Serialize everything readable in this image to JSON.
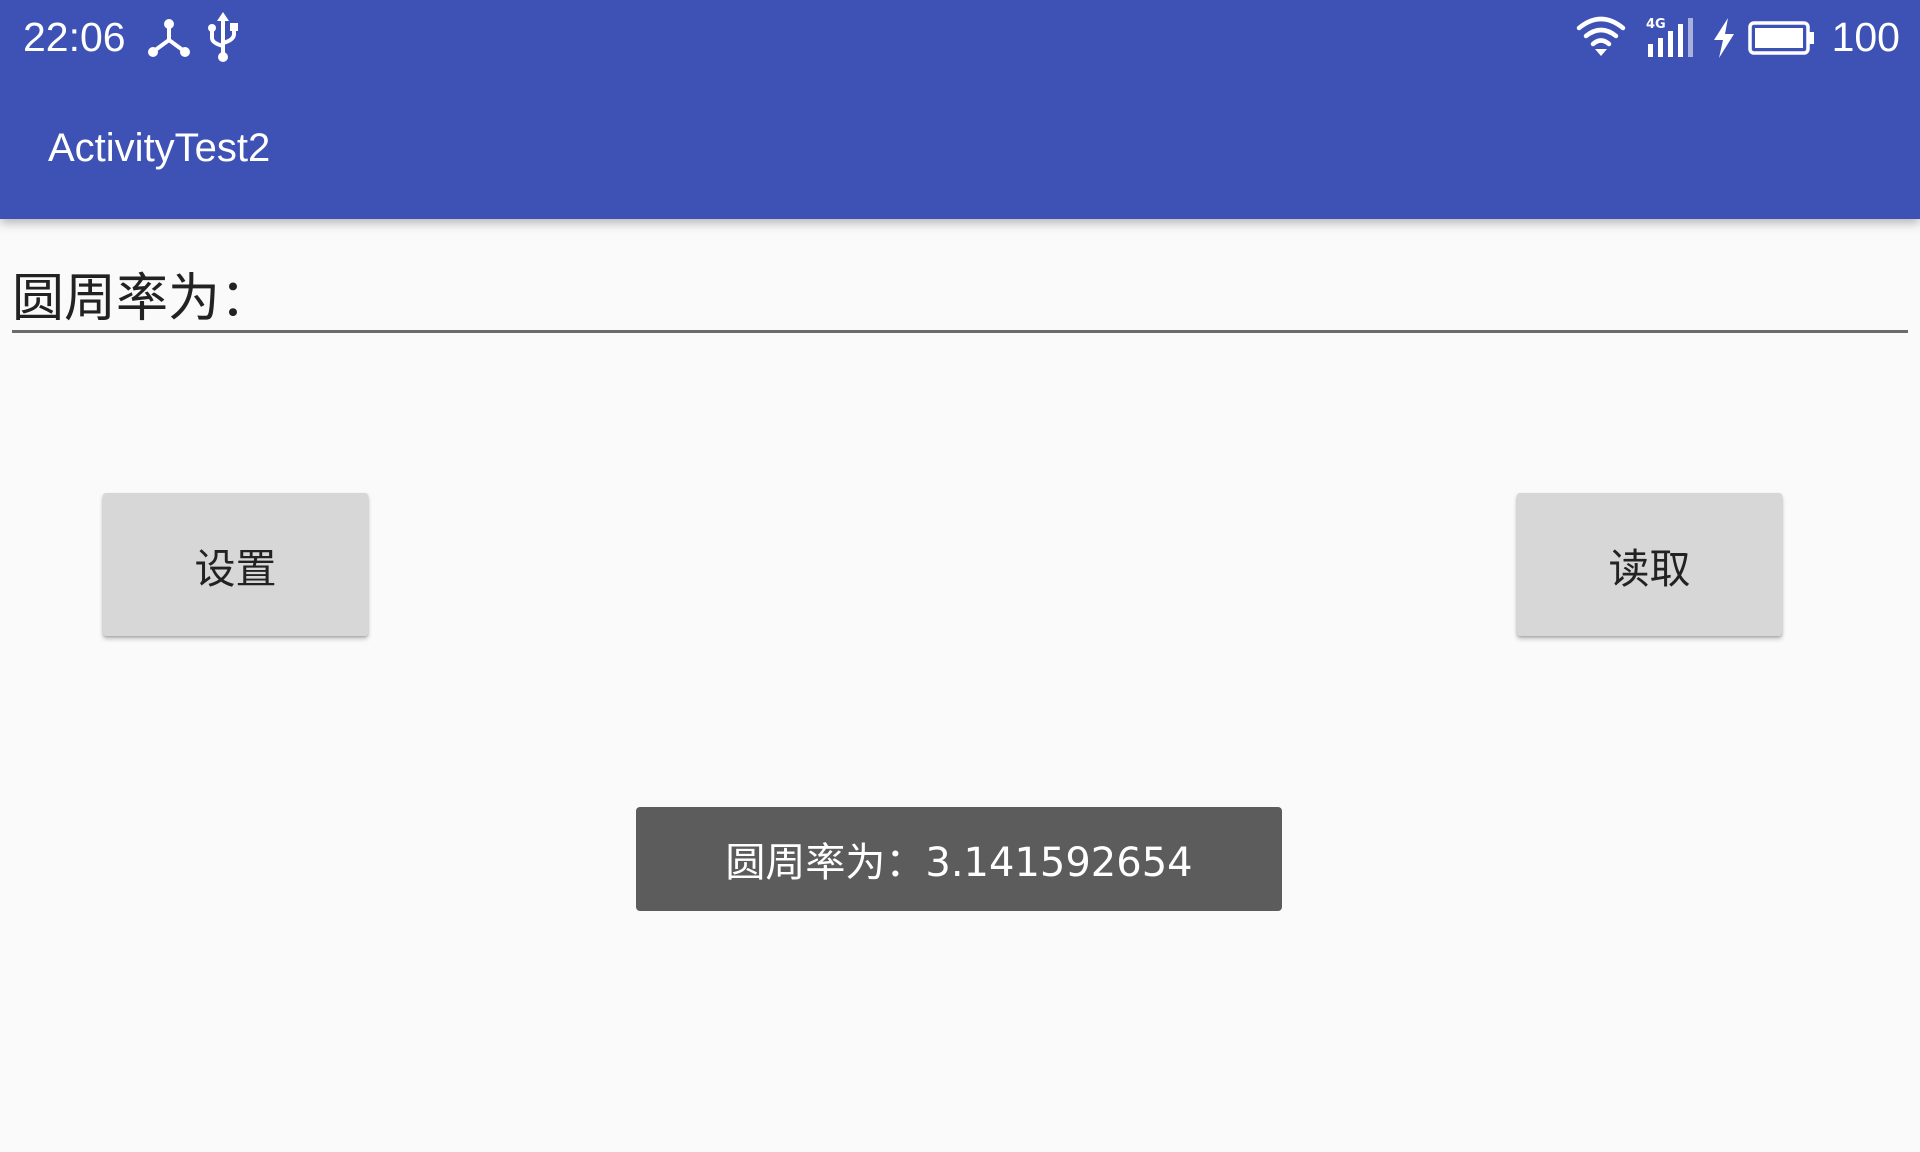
{
  "status_bar": {
    "time": "22:06",
    "battery_level": "100",
    "network_label": "4G",
    "icons": [
      "hotspot-icon",
      "usb-icon",
      "wifi-icon",
      "signal-4g-icon",
      "charging-icon",
      "battery-icon"
    ]
  },
  "app_bar": {
    "title": "ActivityTest2",
    "color": "#3e51b5"
  },
  "form": {
    "input_value": "圆周率为："
  },
  "buttons": {
    "set_label": "设置",
    "read_label": "读取"
  },
  "toast": {
    "message": "圆周率为：3.141592654"
  }
}
